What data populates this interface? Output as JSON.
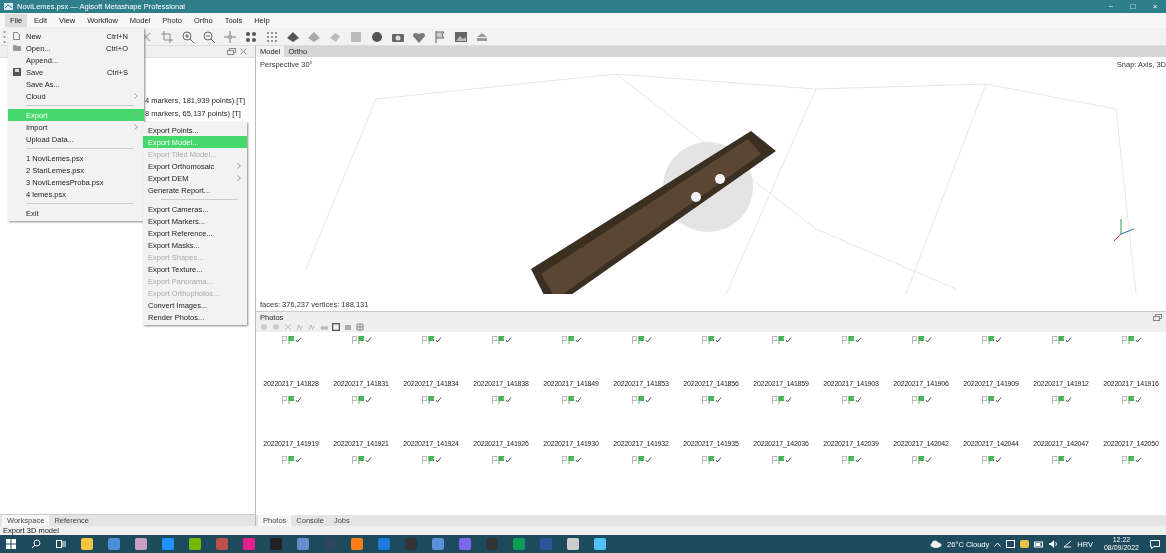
{
  "window": {
    "title": "NoviLemes.psx — Agisoft Metashape Professional",
    "controls": [
      "−",
      "□",
      "×"
    ]
  },
  "menubar": [
    {
      "label": "File",
      "selected": true
    },
    {
      "label": "Edit",
      "selected": false
    },
    {
      "label": "View",
      "selected": false
    },
    {
      "label": "Workflow",
      "selected": false
    },
    {
      "label": "Model",
      "selected": false
    },
    {
      "label": "Photo",
      "selected": false
    },
    {
      "label": "Ortho",
      "selected": false
    },
    {
      "label": "Tools",
      "selected": false
    },
    {
      "label": "Help",
      "selected": false
    }
  ],
  "file_menu": [
    {
      "kind": "item",
      "label": "New",
      "shortcut": "Ctrl+N",
      "submenu": false,
      "selected": false,
      "disabled": false
    },
    {
      "kind": "item",
      "label": "Open...",
      "shortcut": "Ctrl+O",
      "submenu": false,
      "selected": false,
      "disabled": false
    },
    {
      "kind": "item",
      "label": "Append...",
      "submenu": false,
      "selected": false,
      "disabled": false
    },
    {
      "kind": "item",
      "label": "Save",
      "shortcut": "Ctrl+S",
      "submenu": false,
      "selected": false,
      "disabled": false
    },
    {
      "kind": "item",
      "label": "Save As...",
      "submenu": false,
      "selected": false,
      "disabled": false
    },
    {
      "kind": "item",
      "label": "Cloud",
      "submenu": true,
      "selected": false,
      "disabled": false
    },
    {
      "kind": "separator"
    },
    {
      "kind": "item",
      "label": "Export",
      "submenu": true,
      "selected": true,
      "disabled": false
    },
    {
      "kind": "item",
      "label": "Import",
      "submenu": true,
      "selected": false,
      "disabled": false
    },
    {
      "kind": "item",
      "label": "Upload Data...",
      "submenu": false,
      "selected": false,
      "disabled": false
    },
    {
      "kind": "separator"
    },
    {
      "kind": "item",
      "label": "1 NoviLemes.psx",
      "submenu": false,
      "selected": false,
      "disabled": false
    },
    {
      "kind": "item",
      "label": "2 StariLemes.psx",
      "submenu": false,
      "selected": false,
      "disabled": false
    },
    {
      "kind": "item",
      "label": "3 NoviLemesProba.psx",
      "submenu": false,
      "selected": false,
      "disabled": false
    },
    {
      "kind": "item",
      "label": "4 lemes.psx",
      "submenu": false,
      "selected": false,
      "disabled": false
    },
    {
      "kind": "separator"
    },
    {
      "kind": "item",
      "label": "Exit",
      "submenu": false,
      "selected": false,
      "disabled": false
    }
  ],
  "export_menu": [
    {
      "kind": "item",
      "label": "Export Points...",
      "submenu": false,
      "selected": false,
      "disabled": false
    },
    {
      "kind": "item",
      "label": "Export Model...",
      "submenu": false,
      "selected": true,
      "disabled": false
    },
    {
      "kind": "item",
      "label": "Export Tiled Model...",
      "submenu": false,
      "selected": false,
      "disabled": true
    },
    {
      "kind": "item",
      "label": "Export Orthomosaic",
      "submenu": true,
      "selected": false,
      "disabled": false
    },
    {
      "kind": "item",
      "label": "Export DEM",
      "submenu": true,
      "selected": false,
      "disabled": false
    },
    {
      "kind": "item",
      "label": "Generate Report...",
      "submenu": false,
      "selected": false,
      "disabled": false
    },
    {
      "kind": "separator"
    },
    {
      "kind": "item",
      "label": "Export Cameras...",
      "submenu": false,
      "selected": false,
      "disabled": false
    },
    {
      "kind": "item",
      "label": "Export Markers...",
      "submenu": false,
      "selected": false,
      "disabled": false
    },
    {
      "kind": "item",
      "label": "Export Reference...",
      "submenu": false,
      "selected": false,
      "disabled": false
    },
    {
      "kind": "item",
      "label": "Export Masks...",
      "submenu": false,
      "selected": false,
      "disabled": false
    },
    {
      "kind": "item",
      "label": "Export Shapes...",
      "submenu": false,
      "selected": false,
      "disabled": true
    },
    {
      "kind": "item",
      "label": "Export Texture...",
      "submenu": false,
      "selected": false,
      "disabled": false
    },
    {
      "kind": "item",
      "label": "Export Panorama...",
      "submenu": false,
      "selected": false,
      "disabled": true
    },
    {
      "kind": "item",
      "label": "Export Orthophotos...",
      "submenu": false,
      "selected": false,
      "disabled": true
    },
    {
      "kind": "item",
      "label": "Convert Images...",
      "submenu": false,
      "selected": false,
      "disabled": false
    },
    {
      "kind": "item",
      "label": "Render Photos...",
      "submenu": false,
      "selected": false,
      "disabled": false
    }
  ],
  "workspace": {
    "tree": [
      "4 markers, 181,939 points) [T]",
      "8 markers, 65,137 points) [T]"
    ],
    "tabs": [
      {
        "label": "Workspace",
        "selected": true
      },
      {
        "label": "Reference",
        "selected": false
      }
    ]
  },
  "viewport": {
    "tabs": [
      {
        "label": "Model",
        "selected": true
      },
      {
        "label": "Ortho",
        "selected": false
      }
    ],
    "projection": "Perspective 30°",
    "snap": "Snap: Axis, 3D",
    "stats": "faces: 376,237 vertices: 188,131"
  },
  "photos": {
    "title": "Photos",
    "rows": [
      {
        "names": [
          "20220217_141828",
          "20220217_141831",
          "20220217_141834",
          "20220217_141838",
          "20220217_141849",
          "20220217_141853",
          "20220217_141856",
          "20220217_141859",
          "20220217_141903",
          "20220217_141906",
          "20220217_141909",
          "20220217_141912",
          "20220217_141916"
        ]
      },
      {
        "names": [
          "20220217_141919",
          "20220217_141921",
          "20220217_141924",
          "20220217_141926",
          "20220217_141930",
          "20220217_141932",
          "20220217_141935",
          "20220217_142036",
          "20220217_142039",
          "20220217_142042",
          "20220217_142044",
          "20220217_142047",
          "20220217_142050"
        ]
      }
    ],
    "tabs": [
      {
        "label": "Photos",
        "selected": true
      },
      {
        "label": "Console",
        "selected": false
      },
      {
        "label": "Jobs",
        "selected": false
      }
    ]
  },
  "status_bar": "Export 3D model",
  "taskbar": {
    "weather": "26°C Cloudy",
    "language": "HRV",
    "time": "12:22",
    "date": "08/09/2022"
  }
}
